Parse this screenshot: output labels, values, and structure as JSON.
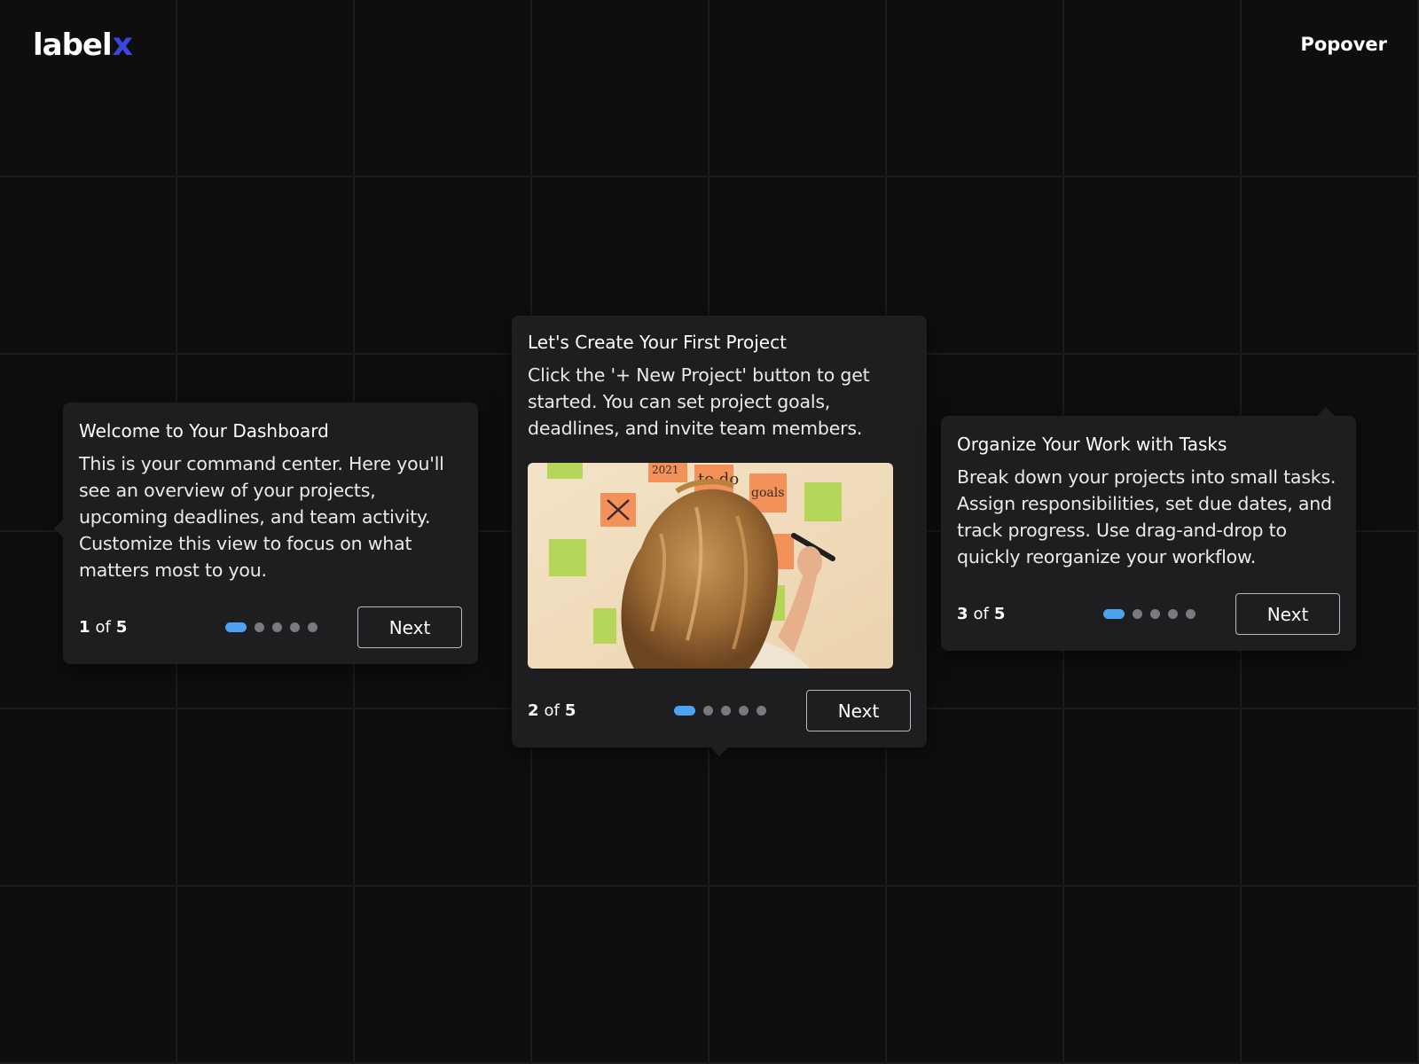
{
  "brand": {
    "logo_text": "label",
    "logo_mark": "x",
    "accent": "#3d45e0"
  },
  "header": {
    "title": "Popover"
  },
  "popovers": [
    {
      "title": "Welcome to Your Dashboard",
      "body": "This is your command center. Here you'll see an overview of your projects, upcoming deadlines, and team activity. Customize this view to focus on what matters most to you.",
      "step": "1",
      "of_label": "of",
      "total": "5",
      "active_dot": 1,
      "next_label": "Next",
      "arrow": "left"
    },
    {
      "title": "Let's Create Your First Project",
      "body": "Click the '+ New Project' button to get started. You can set project goals, deadlines, and invite team members.",
      "image_alt": "Woman writing on sticky notes on a wall",
      "image_notes": [
        "2021",
        "to do",
        "goals"
      ],
      "step": "2",
      "of_label": "of",
      "total": "5",
      "active_dot": 1,
      "next_label": "Next",
      "arrow": "bottom"
    },
    {
      "title": "Organize Your Work with Tasks",
      "body": "Break down your projects into small tasks. Assign responsibilities, set due dates, and track progress. Use drag-and-drop to quickly reorganize your workflow.",
      "step": "3",
      "of_label": "of",
      "total": "5",
      "active_dot": 1,
      "next_label": "Next",
      "arrow": "top"
    }
  ],
  "colors": {
    "background": "#0e0e0f",
    "popover_bg": "#1e1e20",
    "active_dot": "#4da3f2",
    "inactive_dot": "#7a7a7e"
  }
}
